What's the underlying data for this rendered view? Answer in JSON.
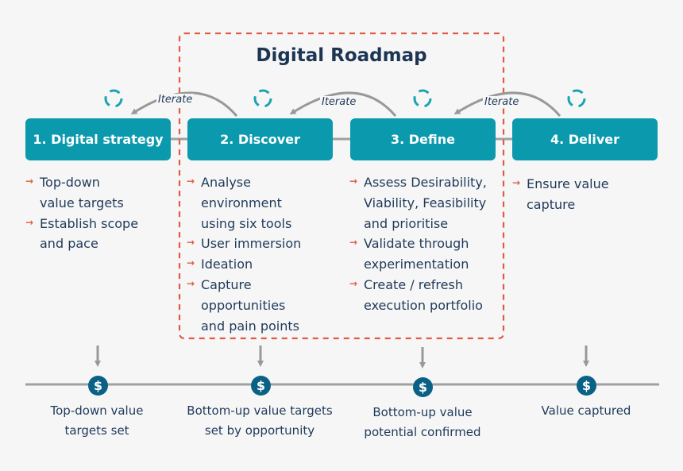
{
  "title": "Digital Roadmap",
  "iterate_label": "Iterate",
  "colors": {
    "stage_fill": "#0b9aad",
    "roadmap_border": "#e05a44",
    "bullet_arrow": "#e05a44",
    "milestone_fill": "#0a6186",
    "text": "#1f3a5a",
    "connector": "#999999"
  },
  "stages": [
    {
      "label": "1. Digital strategy",
      "bullets": [
        [
          "Top-down",
          "value targets"
        ],
        [
          "Establish scope",
          "and pace"
        ]
      ]
    },
    {
      "label": "2. Discover",
      "bullets": [
        [
          "Analyse",
          "environment",
          "using six tools"
        ],
        [
          "User immersion"
        ],
        [
          "Ideation"
        ],
        [
          "Capture",
          "opportunities",
          "and pain points"
        ]
      ]
    },
    {
      "label": "3. Define",
      "bullets": [
        [
          "Assess Desirability,",
          "Viability, Feasibility",
          "and prioritise"
        ],
        [
          "Validate through",
          "experimentation"
        ],
        [
          "Create / refresh",
          "execution portfolio"
        ]
      ]
    },
    {
      "label": "4. Deliver",
      "bullets": [
        [
          "Ensure value",
          "capture"
        ]
      ]
    }
  ],
  "milestones": [
    {
      "icon": "$",
      "label": [
        "Top-down value",
        "targets set"
      ]
    },
    {
      "icon": "$",
      "label": [
        "Bottom-up value targets",
        "set by opportunity"
      ]
    },
    {
      "icon": "$",
      "label": [
        "Bottom-up value",
        "potential confirmed"
      ]
    },
    {
      "icon": "$",
      "label": [
        "Value captured"
      ]
    }
  ]
}
